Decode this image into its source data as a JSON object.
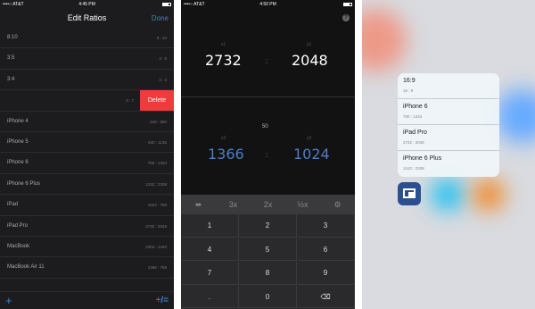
{
  "panel1": {
    "status": {
      "carrier": "••••○ AT&T",
      "time": "4:45 PM"
    },
    "nav": {
      "title": "Edit Ratios",
      "done": "Done"
    },
    "rows": [
      {
        "name": "8:10",
        "value": "8 : 10"
      },
      {
        "name": "3:5",
        "value": "3 : 5"
      },
      {
        "name": "3:4",
        "value": "3 : 4"
      },
      {
        "name": "",
        "value": "3 : 7",
        "swiped": true
      },
      {
        "name": "iPhone 4",
        "value": "640 : 960"
      },
      {
        "name": "iPhone 5",
        "value": "640 : 1136"
      },
      {
        "name": "iPhone 6",
        "value": "750 : 1334"
      },
      {
        "name": "iPhone 6 Plus",
        "value": "1242 : 2208"
      },
      {
        "name": "iPad",
        "value": "1024 : 768"
      },
      {
        "name": "iPad Pro",
        "value": "2732 : 2048"
      },
      {
        "name": "MacBook",
        "value": "2304 : 1440"
      },
      {
        "name": "MacBook Air 11",
        "value": "1366 : 768"
      }
    ],
    "delete_label": "Delete",
    "toolbar": {
      "add": "+",
      "edit": "÷/="
    }
  },
  "panel2": {
    "status": {
      "carrier": "••••○ AT&T",
      "time": "4:50 PM"
    },
    "help": "?",
    "top": {
      "x_label": "x1",
      "y_label": "y1",
      "x_value": "2732",
      "y_value": "2048",
      "colon": ":"
    },
    "cursor_value": "50",
    "bottom": {
      "x_label": "x2",
      "y_label": "y2",
      "x_value": "1366",
      "y_value": "1024",
      "colon": ":"
    },
    "functions": [
      "⬌",
      "3x",
      "2x",
      "½x",
      "⚙"
    ],
    "keys": [
      "1",
      "2",
      "3",
      "4",
      "5",
      "6",
      "7",
      "8",
      "9",
      ".",
      "0",
      "⌫"
    ]
  },
  "panel3": {
    "items": [
      {
        "name": "16:9",
        "value": "16 : 9"
      },
      {
        "name": "iPhone 6",
        "value": "750 : 1334"
      },
      {
        "name": "iPad Pro",
        "value": "2732 : 2048"
      },
      {
        "name": "iPhone 6 Plus",
        "value": "1242 : 2208"
      }
    ]
  }
}
